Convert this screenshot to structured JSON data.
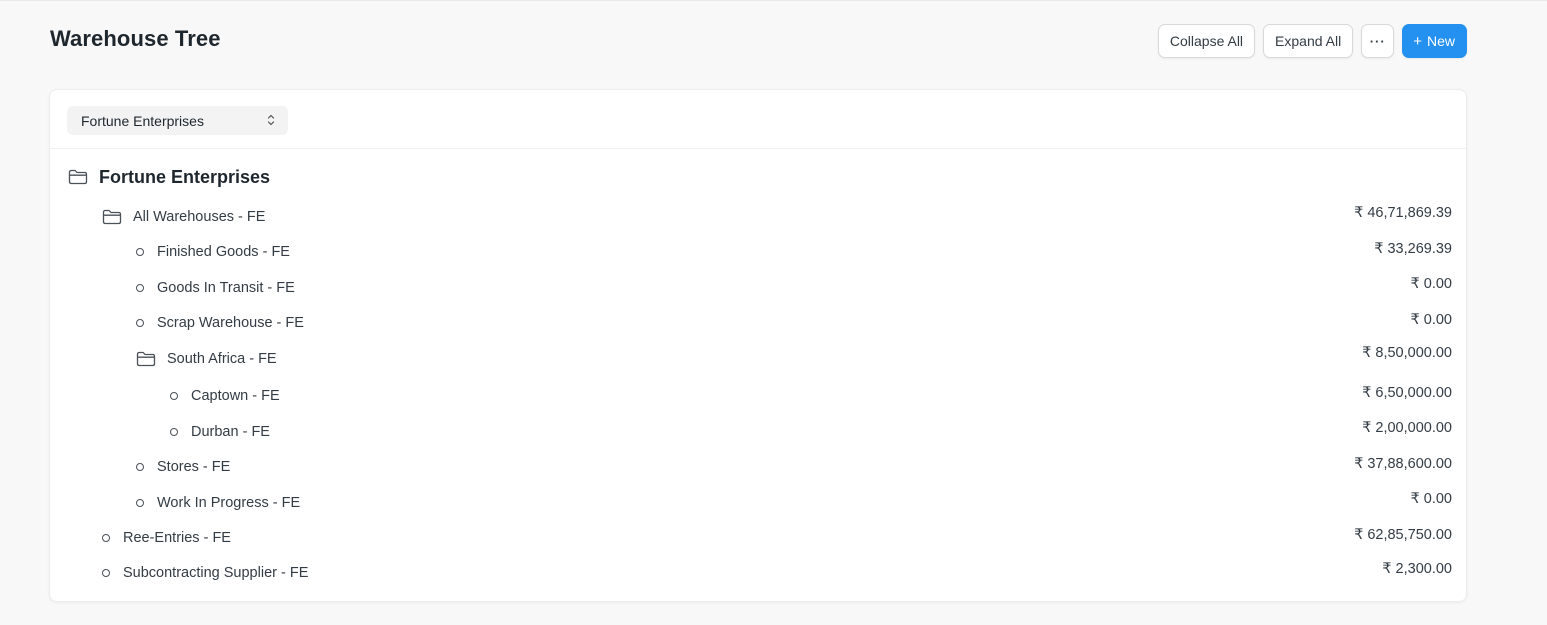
{
  "page": {
    "title": "Warehouse Tree"
  },
  "actions": {
    "collapse_all": "Collapse All",
    "expand_all": "Expand All",
    "more": "···",
    "new_plus": "+",
    "new_label": "New"
  },
  "filter": {
    "company": "Fortune Enterprises"
  },
  "tree": {
    "root": "Fortune Enterprises",
    "nodes": [
      {
        "label": "All Warehouses - FE",
        "balance": "₹ 46,71,869.39",
        "type": "group",
        "depth": 1
      },
      {
        "label": "Finished Goods - FE",
        "balance": "₹ 33,269.39",
        "type": "leaf",
        "depth": 2
      },
      {
        "label": "Goods In Transit - FE",
        "balance": "₹ 0.00",
        "type": "leaf",
        "depth": 2
      },
      {
        "label": "Scrap Warehouse - FE",
        "balance": "₹ 0.00",
        "type": "leaf",
        "depth": 2
      },
      {
        "label": "South Africa - FE",
        "balance": "₹ 8,50,000.00",
        "type": "group",
        "depth": 2
      },
      {
        "label": "Captown - FE",
        "balance": "₹ 6,50,000.00",
        "type": "leaf",
        "depth": 3
      },
      {
        "label": "Durban - FE",
        "balance": "₹ 2,00,000.00",
        "type": "leaf",
        "depth": 3
      },
      {
        "label": "Stores - FE",
        "balance": "₹ 37,88,600.00",
        "type": "leaf",
        "depth": 2
      },
      {
        "label": "Work In Progress - FE",
        "balance": "₹ 0.00",
        "type": "leaf",
        "depth": 2
      },
      {
        "label": "Ree-Entries - FE",
        "balance": "₹ 62,85,750.00",
        "type": "leaf",
        "depth": 1
      },
      {
        "label": "Subcontracting Supplier - FE",
        "balance": "₹ 2,300.00",
        "type": "leaf",
        "depth": 1
      }
    ]
  },
  "icons": {
    "group": "folder-icon",
    "leaf": "circle-icon",
    "select": "chevron-up-down-icon"
  },
  "colors": {
    "primary": "#2490ef",
    "background": "#f8f8f8"
  }
}
